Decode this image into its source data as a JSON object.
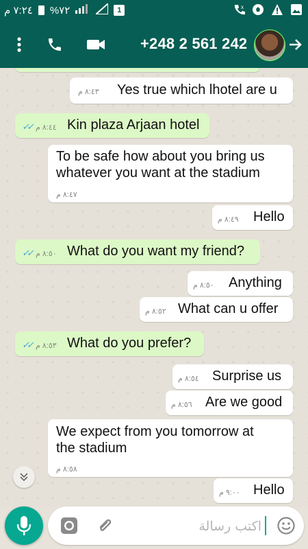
{
  "status_bar": {
    "time": "٧:٢٤ م",
    "battery": "%٧٢",
    "sim_label": "1"
  },
  "header": {
    "title": "+248 2 561 242"
  },
  "messages": [
    {
      "time": "٨:٤٣ م",
      "text": "Yes true which lhotel are u"
    },
    {
      "time": "٨:٤٤ م",
      "text": "Kin plaza Arjaan hotel"
    },
    {
      "time": "٨:٤٧ م",
      "text": "To be safe how about you bring us whatever you want at the stadium"
    },
    {
      "time": "٨:٤٩ م",
      "text": "Hello"
    },
    {
      "time": "٨:٥٠ م",
      "text": "What do you want my friend?"
    },
    {
      "time": "٨:٥٠ م",
      "text": "Anything"
    },
    {
      "time": "٨:٥٢ م",
      "text": "What can u offer"
    },
    {
      "time": "٨:٥٣ م",
      "text": "What do you prefer?"
    },
    {
      "time": "٨:٥٤ م",
      "text": "Surprise us"
    },
    {
      "time": "٨:٥٦ م",
      "text": "Are we good"
    },
    {
      "time": "٨:٥٨ م",
      "text": "We expect from you tomorrow at the stadium"
    },
    {
      "time": "٩:٠٠ م",
      "text": "Hello"
    }
  ],
  "composer": {
    "placeholder": "اكتب رسالة"
  },
  "colors": {
    "header": "#075e54",
    "outgoing": "#dcf8c6",
    "incoming": "#ffffff",
    "accent": "#06a891",
    "read_ticks": "#3aa0d8"
  }
}
